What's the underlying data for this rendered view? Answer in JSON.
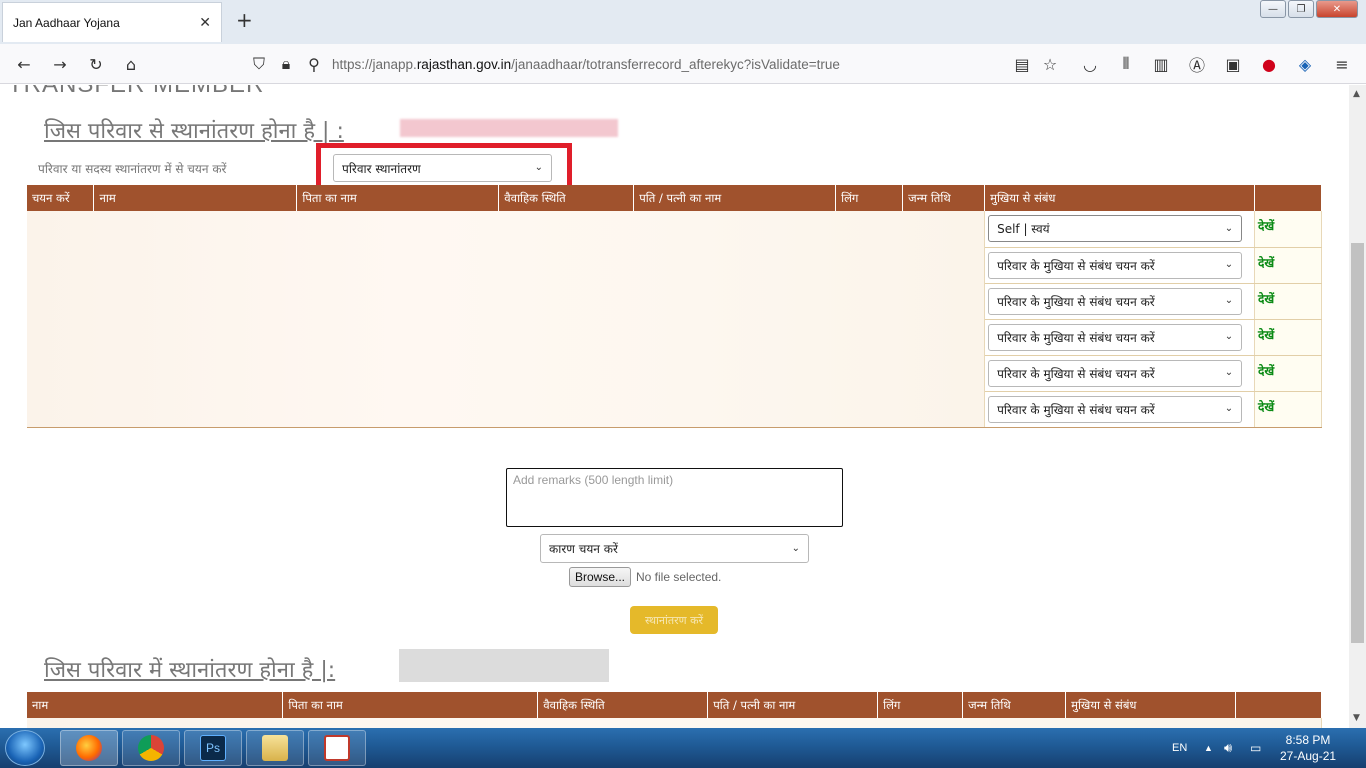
{
  "browser": {
    "tab_title": "Jan Aadhaar Yojana",
    "tab_close": "✕",
    "new_tab": "+",
    "url_prefix": "https://janapp.",
    "url_host": "rajasthan.gov.in",
    "url_path": "/janaadhaar/totransferrecord_afterekyc?isValidate=true"
  },
  "page": {
    "cut_heading": "TRANSFER MEMBER",
    "from_family_title": "जिस परिवार से स्थानांतरण होना है | :",
    "select_label": "परिवार या सदस्य स्थानांतरण में से चयन करें",
    "transfer_type_value": "परिवार स्थानांतरण",
    "table1_headers": [
      "चयन करें",
      "नाम",
      "पिता का नाम",
      "वैवाहिक स्थिति",
      "पति / पत्नी का नाम",
      "लिंग",
      "जन्म तिथि",
      "मुखिया से संबंध",
      ""
    ],
    "relation_rows": [
      {
        "relation": "Self | स्वयं",
        "view": "देखें"
      },
      {
        "relation": "परिवार के मुखिया से संबंध चयन करें",
        "view": "देखें"
      },
      {
        "relation": "परिवार के मुखिया से संबंध चयन करें",
        "view": "देखें"
      },
      {
        "relation": "परिवार के मुखिया से संबंध चयन करें",
        "view": "देखें"
      },
      {
        "relation": "परिवार के मुखिया से संबंध चयन करें",
        "view": "देखें"
      },
      {
        "relation": "परिवार के मुखिया से संबंध चयन करें",
        "view": "देखें"
      }
    ],
    "remarks_placeholder": "Add remarks (500 length limit)",
    "reason_select_value": "कारण चयन करें",
    "browse_label": "Browse...",
    "no_file_label": "No file selected.",
    "transfer_button": "स्थानांतरण करें",
    "to_family_title": "जिस परिवार में स्थानांतरण होना है |:",
    "table2_headers": [
      "नाम",
      "पिता का नाम",
      "वैवाहिक स्थिति",
      "पति / पत्नी का नाम",
      "लिंग",
      "जन्म तिथि",
      "मुखिया से संबंध",
      ""
    ]
  },
  "taskbar": {
    "lang": "EN",
    "time": "8:58 PM",
    "date": "27-Aug-21",
    "apps": [
      "firefox-icon",
      "chrome-icon",
      "photoshop-icon",
      "file-explorer-icon",
      "pdf-reader-icon"
    ],
    "ps_label": "Ps"
  },
  "colors": {
    "header_bg": "#a0522d",
    "highlight": "#e01e2a",
    "view_link": "#0a8a14",
    "transfer_button": "#e5b92a"
  }
}
